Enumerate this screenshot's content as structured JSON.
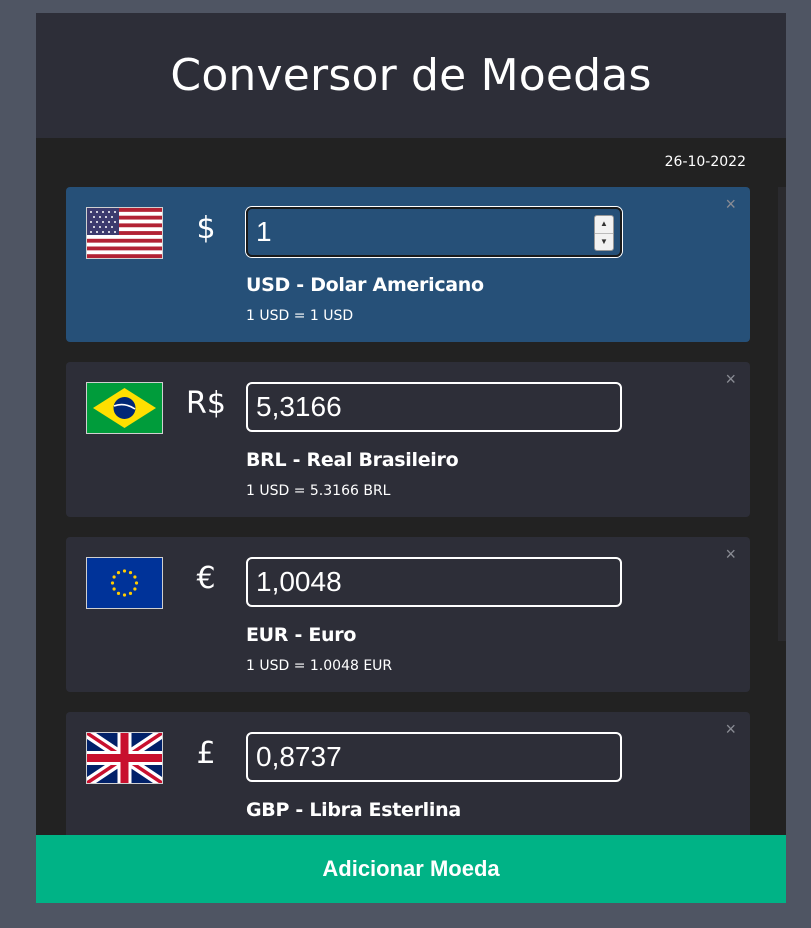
{
  "header": {
    "title": "Conversor de Moedas"
  },
  "date": "26-10-2022",
  "currencies": [
    {
      "code": "USD",
      "symbol": "$",
      "value": "1",
      "name": "USD - Dolar Americano",
      "rate": "1 USD = 1 USD",
      "flag_icon": "us-flag-icon",
      "base": true
    },
    {
      "code": "BRL",
      "symbol": "R$",
      "value": "5,3166",
      "name": "BRL - Real Brasileiro",
      "rate": "1 USD = 5.3166 BRL",
      "flag_icon": "brazil-flag-icon",
      "base": false
    },
    {
      "code": "EUR",
      "symbol": "€",
      "value": "1,0048",
      "name": "EUR - Euro",
      "rate": "1 USD = 1.0048 EUR",
      "flag_icon": "eu-flag-icon",
      "base": false
    },
    {
      "code": "GBP",
      "symbol": "£",
      "value": "0,8737",
      "name": "GBP - Libra Esterlina",
      "rate": "",
      "flag_icon": "uk-flag-icon",
      "base": false
    }
  ],
  "close_label": "×",
  "spinner": {
    "up": "▲",
    "down": "▼"
  },
  "add_button": {
    "label": "Adicionar Moeda"
  },
  "colors": {
    "background": "#4f5563",
    "header": "#2d2e38",
    "card": "#2d2e38",
    "base_card": "#265078",
    "accent": "#00b386"
  }
}
